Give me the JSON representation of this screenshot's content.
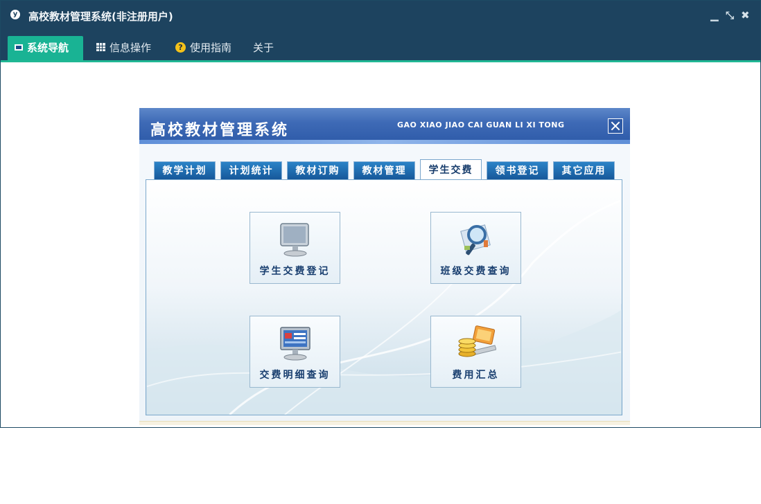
{
  "app": {
    "title": "高校教材管理系统(非注册用户)",
    "controls": {
      "minimize": "▁",
      "restore": "⤡",
      "close": "✖"
    }
  },
  "nav": {
    "tabs": [
      {
        "label": "系统导航",
        "icon": "monitor-icon",
        "active": true
      },
      {
        "label": "信息操作",
        "icon": "grid-icon",
        "active": false
      },
      {
        "label": "使用指南",
        "icon": "help-icon",
        "active": false
      },
      {
        "label": "关于",
        "icon": "",
        "active": false
      }
    ]
  },
  "dialog": {
    "title": "高校教材管理系统",
    "pinyin": "GAO XIAO JIAO CAI GUAN LI XI TONG",
    "tabs": [
      {
        "label": "教学计划",
        "active": false
      },
      {
        "label": "计划统计",
        "active": false
      },
      {
        "label": "教材订购",
        "active": false
      },
      {
        "label": "教材管理",
        "active": false
      },
      {
        "label": "学生交费",
        "active": true
      },
      {
        "label": "领书登记",
        "active": false
      },
      {
        "label": "其它应用",
        "active": false
      }
    ],
    "tiles": [
      {
        "label": "学生交费登记",
        "icon": "monitor-icon"
      },
      {
        "label": "班级交费查询",
        "icon": "magnifier-icon"
      },
      {
        "label": "交费明细查询",
        "icon": "screen-report-icon"
      },
      {
        "label": "费用汇总",
        "icon": "coins-laptop-icon"
      }
    ]
  },
  "colors": {
    "titlebar": "#1d435f",
    "accent": "#19b394",
    "dialog_header": "#2d5aa8",
    "tab_blue": "#16589a"
  }
}
